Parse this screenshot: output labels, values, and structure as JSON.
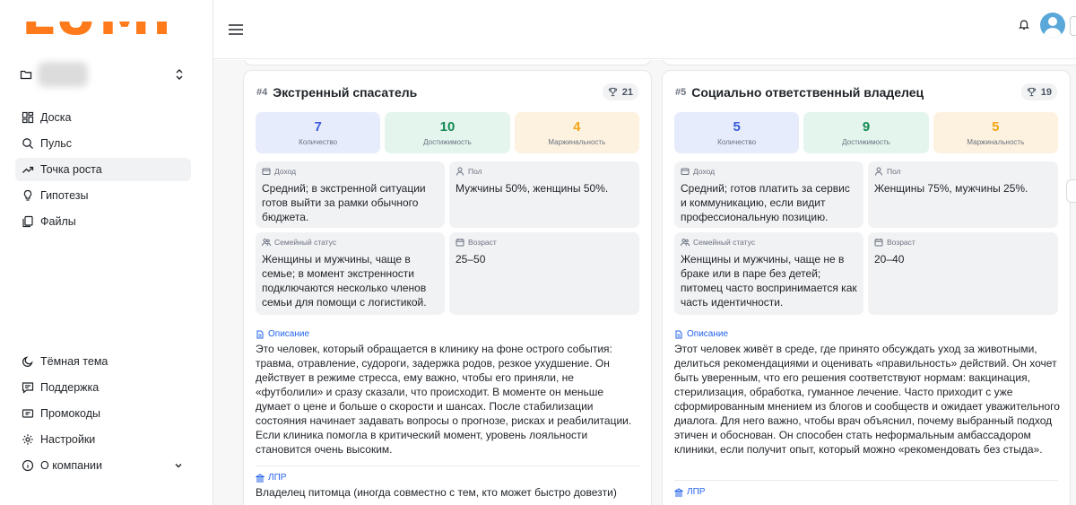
{
  "logo_text": "LUMI",
  "sidebar": {
    "top_items": [
      {
        "label": "Доска",
        "icon": "dashboard-icon"
      },
      {
        "label": "Пульс",
        "icon": "search-icon"
      },
      {
        "label": "Точка роста",
        "icon": "trend-up-icon",
        "active": true
      },
      {
        "label": "Гипотезы",
        "icon": "lightbulb-icon"
      },
      {
        "label": "Файлы",
        "icon": "files-icon"
      }
    ],
    "bottom_items": [
      {
        "label": "Тёмная тема",
        "icon": "moon-icon"
      },
      {
        "label": "Поддержка",
        "icon": "chat-icon"
      },
      {
        "label": "Промокоды",
        "icon": "ticket-icon"
      },
      {
        "label": "Настройки",
        "icon": "gear-icon"
      },
      {
        "label": "О компании",
        "icon": "info-icon"
      }
    ]
  },
  "colors": {
    "brand": "#ff7a1a",
    "accent_link": "#2563eb",
    "quantity_bg": "#e6ecfb",
    "quantity_fg": "#3b5bdb",
    "reach_bg": "#e4f5ee",
    "reach_fg": "#148a52",
    "margin_bg": "#fdf2df",
    "margin_fg": "#f2a516"
  },
  "cards": [
    {
      "num": "#4",
      "title": "Экстренный спасатель",
      "score": "21",
      "metrics": [
        {
          "value": "7",
          "label": "Количество"
        },
        {
          "value": "10",
          "label": "Достижимость"
        },
        {
          "value": "4",
          "label": "Маржинальность"
        }
      ],
      "income_label": "Доход",
      "income": "Средний; в экстренной ситуации готов выйти за рамки обычного бюджета.",
      "gender_label": "Пол",
      "gender": "Мужчины 50%, женщины 50%.",
      "family_label": "Семейный статус",
      "family": "Женщины и мужчины, чаще в семье; в момент экстренности подключаются несколько членов семьи для помощи с логистикой.",
      "age_label": "Возраст",
      "age": "25–50",
      "desc_title": "Описание",
      "desc": "Это человек, который обращается в клинику на фоне острого события: травма, отравление, судороги, задержка родов, резкое ухудшение. Он действует в режиме стресса, ему важно, чтобы его приняли, не «футболили» и сразу сказали, что происходит. В моменте он меньше думает о цене и больше о скорости и шансах. После стабилизации состояния начинает задавать вопросы о прогнозе, рисках и реабилитации. Если клиника помогла в критический момент, уровень лояльности становится очень высоким.",
      "lpr_title": "ЛПР",
      "lpr": "Владелец питомца (иногда совместно с тем, кто может быстро довезти)"
    },
    {
      "num": "#5",
      "title": "Социально ответственный владелец",
      "score": "19",
      "metrics": [
        {
          "value": "5",
          "label": "Количество"
        },
        {
          "value": "9",
          "label": "Достижимость"
        },
        {
          "value": "5",
          "label": "Маржинальность"
        }
      ],
      "income_label": "Доход",
      "income": "Средний; готов платить за сервис и коммуникацию, если видит профессиональную позицию.",
      "gender_label": "Пол",
      "gender": "Женщины 75%, мужчины 25%.",
      "family_label": "Семейный статус",
      "family": "Женщины и мужчины, чаще не в браке или в паре без детей; питомец часто воспринимается как часть идентичности.",
      "age_label": "Возраст",
      "age": "20–40",
      "desc_title": "Описание",
      "desc": "Этот человек живёт в среде, где принято обсуждать уход за животными, делиться рекомендациями и оценивать «правильность» действий. Он хочет быть уверенным, что его решения соответствуют нормам: вакцинация, стерилизация, обработка, гуманное лечение. Часто приходит с уже сформированным мнением из блогов и сообществ и ожидает уважительного диалога. Для него важно, чтобы врач объяснил, почему выбранный подход этичен и обоснован. Он способен стать неформальным амбассадором клиники, если получит опыт, который можно «рекомендовать без стыда».",
      "lpr_title": "ЛПР"
    }
  ]
}
